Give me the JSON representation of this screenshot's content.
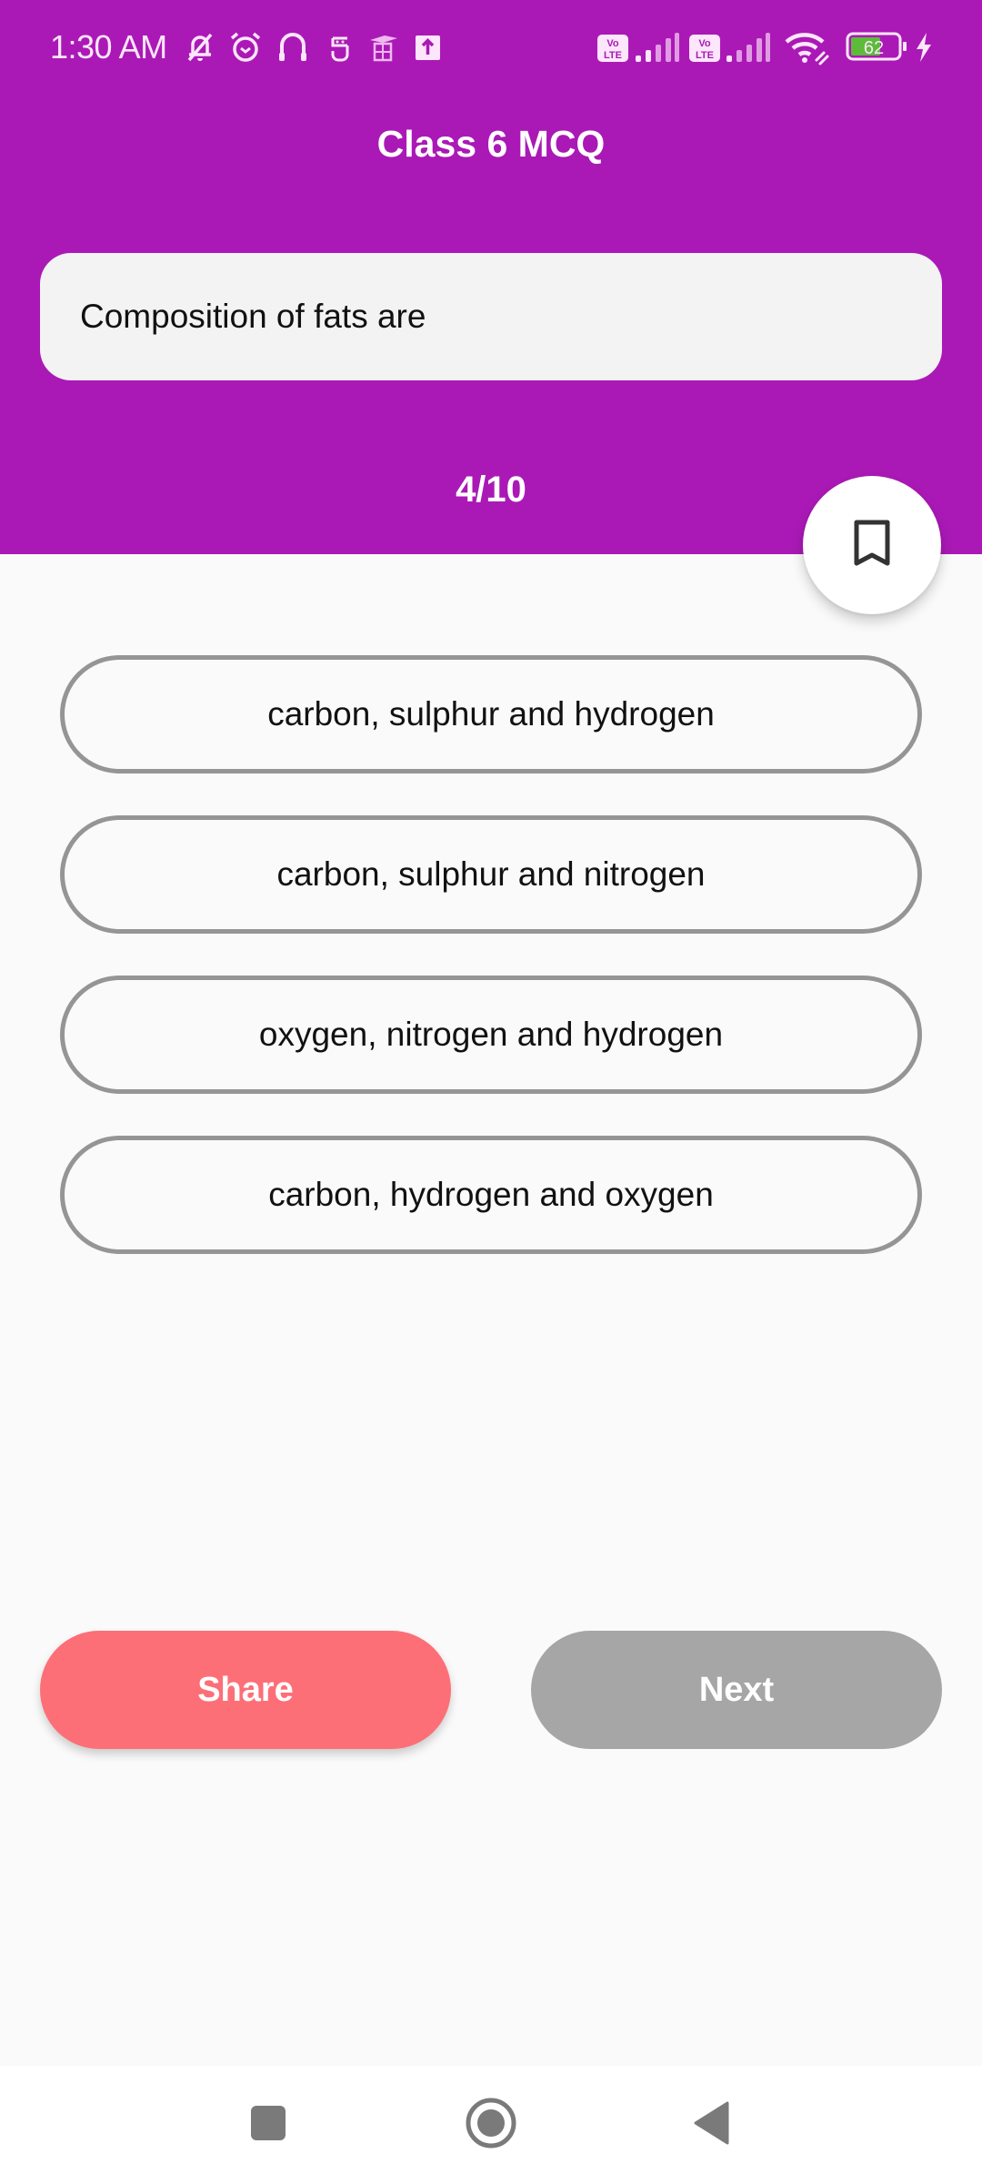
{
  "status_bar": {
    "time": "1:30 AM",
    "left_icons": [
      "notifications-muted-icon",
      "alarm-icon",
      "headphones-icon",
      "app-notification-icon",
      "education-app-icon",
      "upload-icon"
    ],
    "right_icons": [
      "volte-icon",
      "signal-icon",
      "volte-icon",
      "signal-icon",
      "wifi-icon",
      "battery-icon",
      "charging-icon"
    ],
    "battery_level": "62",
    "colors": {
      "battery_fill": "#5dbb3a"
    }
  },
  "header": {
    "title": "Class 6 MCQ",
    "background_color": "#aa19b6"
  },
  "question": {
    "text": "Composition of fats are",
    "counter": "4/10",
    "bookmark_icon": "bookmark-outline-icon"
  },
  "options": [
    {
      "label": "carbon, sulphur and hydrogen"
    },
    {
      "label": "carbon, sulphur and nitrogen"
    },
    {
      "label": "oxygen, nitrogen and hydrogen"
    },
    {
      "label": "carbon, hydrogen and oxygen"
    }
  ],
  "actions": {
    "share_label": "Share",
    "next_label": "Next",
    "share_color": "#fd6f77",
    "next_color": "#a6a6a6"
  },
  "nav_bar": {
    "items": [
      "recents-icon",
      "home-icon",
      "back-icon"
    ]
  }
}
